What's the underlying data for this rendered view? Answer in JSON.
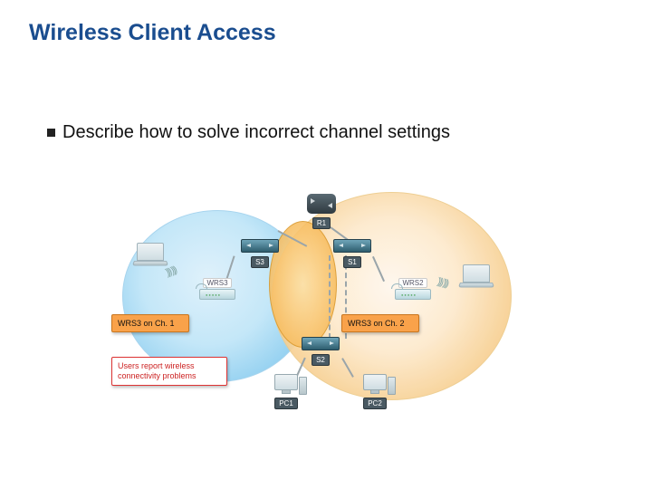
{
  "title": "Wireless Client Access",
  "bullet": "Describe how to solve incorrect channel settings",
  "nodes": {
    "router": "R1",
    "s1": "S1",
    "s2": "S2",
    "s3": "S3",
    "wrs3": "WRS3",
    "wrs2": "WRS2",
    "pc1": "PC1",
    "pc2": "PC2"
  },
  "callouts": {
    "ch1": "WRS3 on Ch. 1",
    "ch2": "WRS3 on Ch. 2",
    "issue": "Users report wireless connectivity problems"
  },
  "waves": "))) )))"
}
